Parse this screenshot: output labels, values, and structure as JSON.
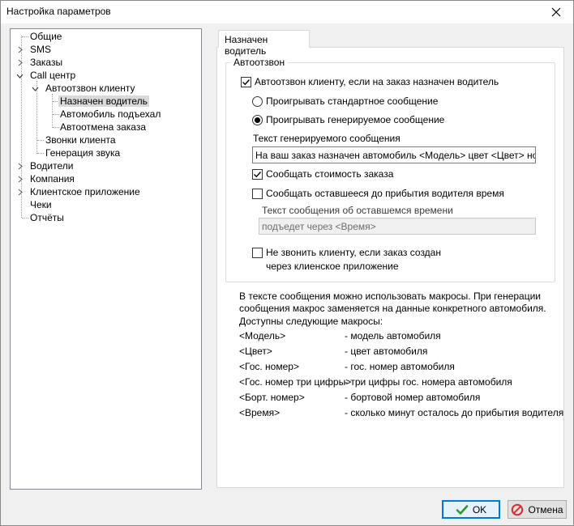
{
  "window": {
    "title": "Настройка параметров"
  },
  "tree": {
    "items": [
      {
        "label": "Общие"
      },
      {
        "label": "SMS"
      },
      {
        "label": "Заказы"
      },
      {
        "label": "Call центр"
      },
      {
        "label": "Автоотзвон клиенту"
      },
      {
        "label": "Назначен водитель",
        "selected": true
      },
      {
        "label": "Автомобиль подъехал"
      },
      {
        "label": "Автоотмена заказа"
      },
      {
        "label": "Звонки клиента"
      },
      {
        "label": "Генерация звука"
      },
      {
        "label": "Водители"
      },
      {
        "label": "Компания"
      },
      {
        "label": "Клиентское приложение"
      },
      {
        "label": "Чеки"
      },
      {
        "label": "Отчёты"
      }
    ]
  },
  "tab": {
    "label": "Назначен водитель"
  },
  "group": {
    "title": "Автоотзвон",
    "autocall": {
      "label": "Автоотзвон клиенту, если на заказ назначен водитель",
      "checked": true
    },
    "radio_standard": {
      "label": "Проигрывать стандартное сообщение",
      "checked": false
    },
    "radio_generated": {
      "label": "Проигрывать генерируемое сообщение",
      "checked": true
    },
    "msg_text_label": "Текст генерируемого сообщения",
    "msg_text_value": "На ваш заказ назначен автомобиль <Модель> цвет <Цвет> номер",
    "report_cost": {
      "label": "Сообщать стоимость заказа",
      "checked": true
    },
    "report_time": {
      "label": "Сообщать оставшееся до прибытия водителя время",
      "checked": false
    },
    "time_text_label": "Текст сообщения об оставшемся времени",
    "time_text_value": "подъедет через <Время>",
    "no_call": {
      "label_line1": "Не звонить клиенту, если заказ создан",
      "label_line2": "через клиенское приложение",
      "checked": false
    }
  },
  "help": {
    "line1": "В тексте сообщения можно использовать макросы. При генерации",
    "line2": "сообщения макрос заменяется на данные конкретного автомобиля.",
    "line3": "Доступны следующие макросы:",
    "macros": [
      {
        "name": "<Модель>",
        "desc": "- модель автомобиля"
      },
      {
        "name": "<Цвет>",
        "desc": "- цвет автомобиля"
      },
      {
        "name": "<Гос. номер>",
        "desc": "- гос. номер автомобиля"
      },
      {
        "name": "<Гос. номер три цифры>",
        "desc": "- три цифры гос. номера автомобиля"
      },
      {
        "name": "<Борт. номер>",
        "desc": "- бортовой номер автомобиля"
      },
      {
        "name": "<Время>",
        "desc": "- сколько минут осталось до прибытия водителя"
      }
    ]
  },
  "buttons": {
    "ok": "OK",
    "cancel": "Отмена"
  },
  "colors": {
    "accent": "#0078d7",
    "ok_icon": "#2e9a2e",
    "cancel_icon": "#d32f2f"
  }
}
